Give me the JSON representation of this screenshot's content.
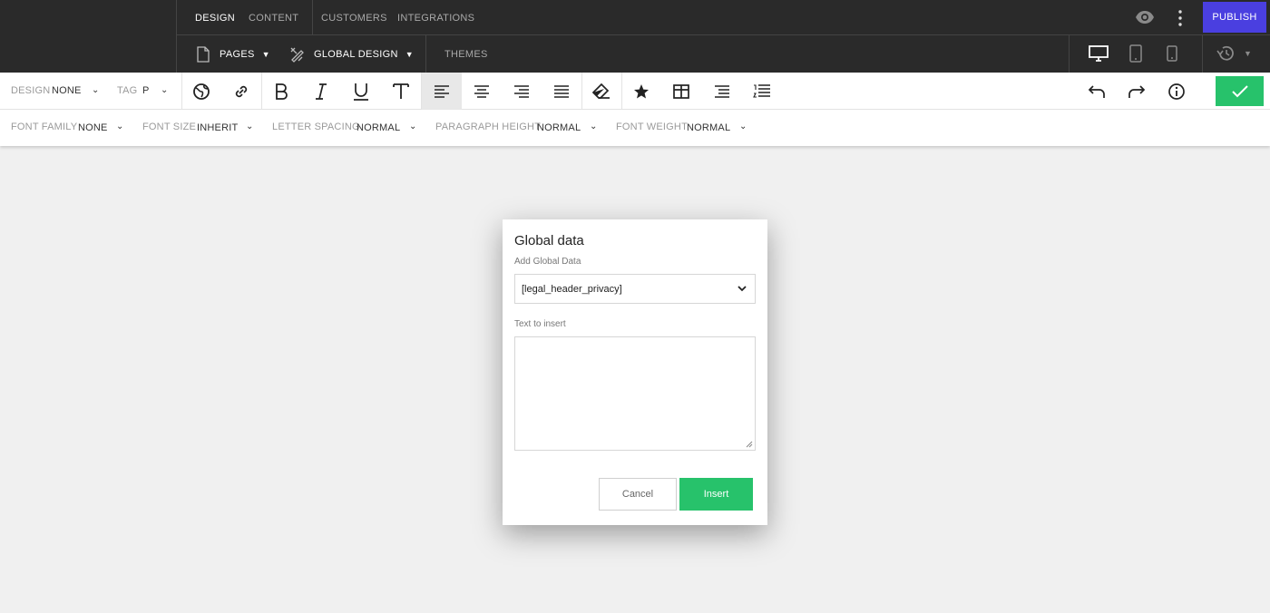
{
  "topnav": {
    "tabs": [
      {
        "label": "DESIGN"
      },
      {
        "label": "CONTENT"
      },
      {
        "label": "CUSTOMERS"
      },
      {
        "label": "INTEGRATIONS"
      }
    ],
    "publish_label": "PUBLISH",
    "pages_label": "PAGES",
    "global_design_label": "GLOBAL DESIGN",
    "themes_label": "THEMES"
  },
  "toolbar": {
    "design_label": "DESIGN",
    "design_value": "NONE",
    "tag_label": "TAG",
    "tag_value": "P",
    "icons": [
      "globe-icon",
      "link-icon",
      "bold-icon",
      "italic-icon",
      "underline-icon",
      "text-icon",
      "align-left-icon",
      "align-center-icon",
      "align-right-icon",
      "align-justify-icon",
      "eraser-icon",
      "star-icon",
      "table-icon",
      "bulleted-list-icon",
      "numbered-list-icon",
      "undo-icon",
      "redo-icon",
      "info-icon",
      "check-icon"
    ]
  },
  "fontbar": {
    "font_family_label": "FONT FAMILY",
    "font_family_value": "NONE",
    "font_size_label": "FONT SIZE",
    "font_size_value": "INHERIT",
    "letter_spacing_label": "LETTER SPACING",
    "letter_spacing_value": "NORMAL",
    "paragraph_height_label": "PARAGRAPH HEIGHT",
    "paragraph_height_value": "NORMAL",
    "font_weight_label": "FONT WEIGHT",
    "font_weight_value": "NORMAL"
  },
  "modal": {
    "title": "Global data",
    "add_label": "Add Global Data",
    "select_value": "[legal_header_privacy]",
    "text_label": "Text to insert",
    "text_value": "",
    "cancel_label": "Cancel",
    "insert_label": "Insert"
  },
  "colors": {
    "topbar_bg": "#2a2a2a",
    "publish_bg": "#4a3fe0",
    "confirm_bg": "#27c26b",
    "canvas_bg": "#f0f0f0"
  }
}
